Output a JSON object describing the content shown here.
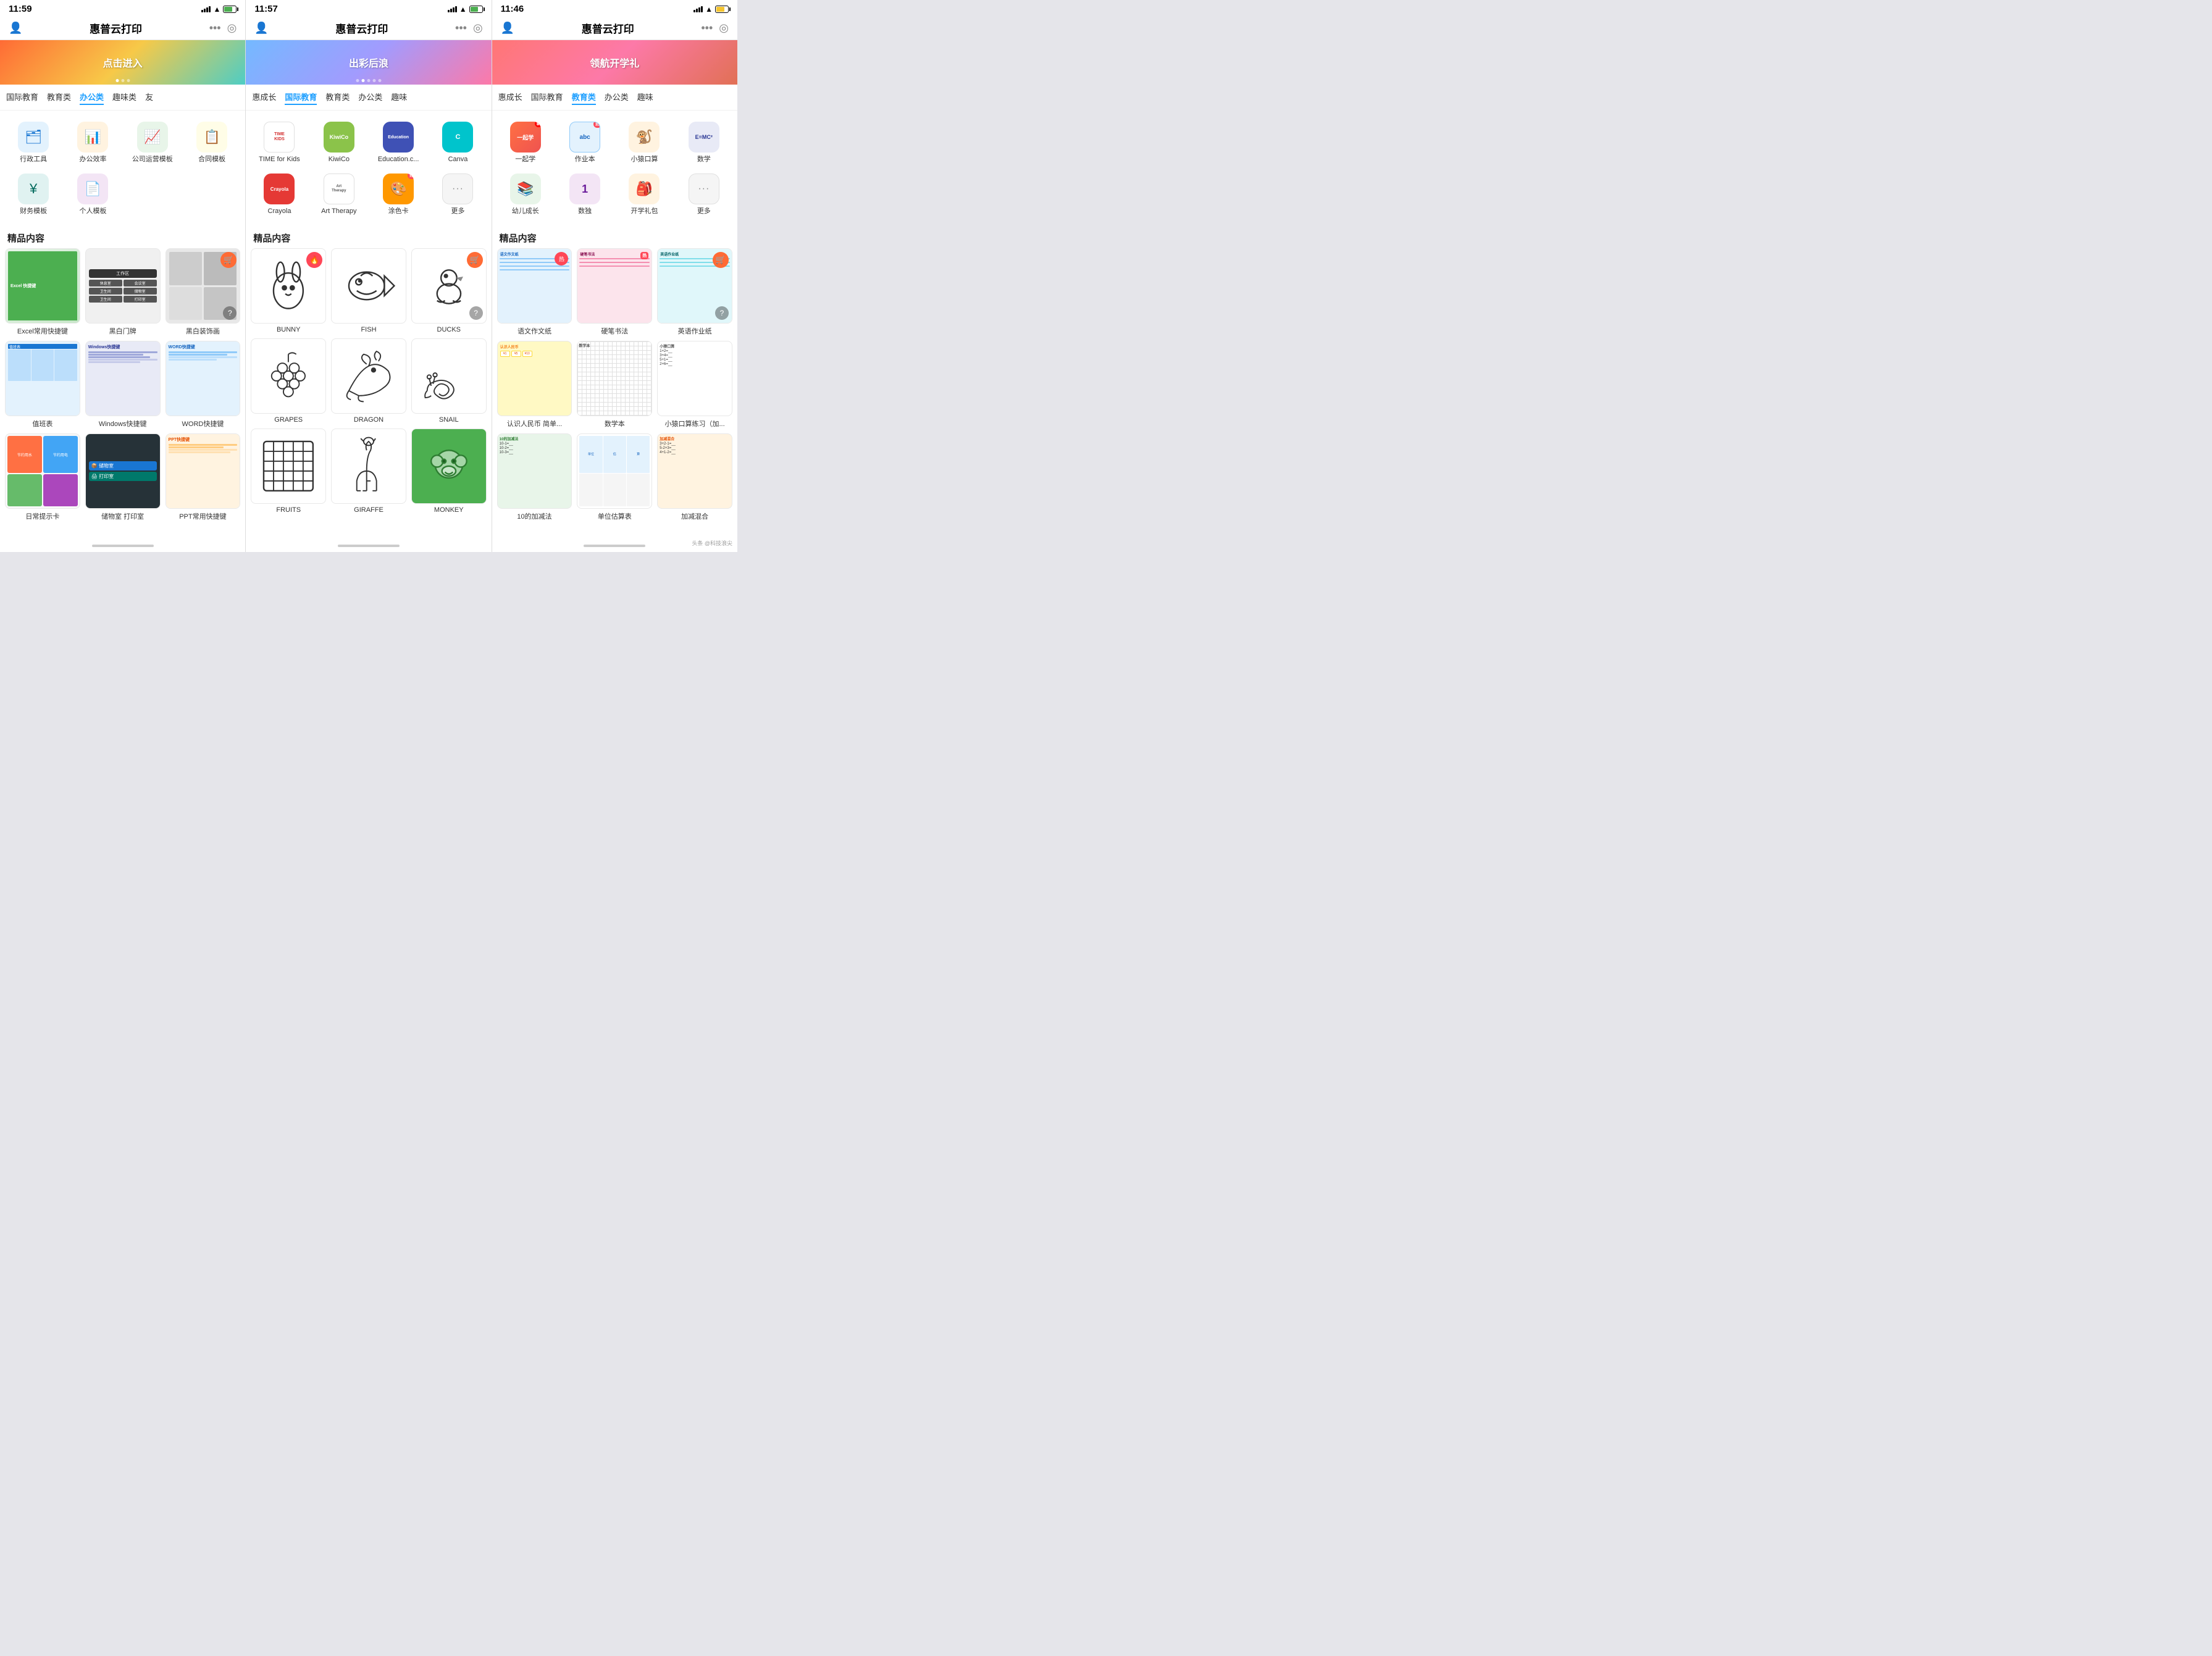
{
  "screens": [
    {
      "id": "screen-1",
      "time": "11:59",
      "header_title": "惠普云打印",
      "banner_text": "点击进入",
      "banner_class": "banner-1",
      "categories": [
        "国际教育",
        "教育类",
        "办公类",
        "趣味类",
        "友"
      ],
      "active_cat": 2,
      "apps": [
        {
          "label": "行政工具",
          "icon": "🗂",
          "bg": "icon-blue"
        },
        {
          "label": "办公效率",
          "icon": "📊",
          "bg": "icon-orange"
        },
        {
          "label": "公司运营模板",
          "icon": "📈",
          "bg": "icon-green"
        },
        {
          "label": "合同模板",
          "icon": "📋",
          "bg": "icon-yellow"
        },
        {
          "label": "财务模板",
          "icon": "¥",
          "bg": "icon-teal"
        },
        {
          "label": "个人模板",
          "icon": "📄",
          "bg": "icon-purple"
        }
      ],
      "section_label": "精品内容",
      "content_items": [
        {
          "label": "Excel常用快捷键",
          "type": "excel",
          "has_hot": false
        },
        {
          "label": "黑白门牌",
          "type": "door",
          "has_hot": false
        },
        {
          "label": "黑白装饰画",
          "type": "decor",
          "has_cart": true,
          "has_help": true
        },
        {
          "label": "值班表",
          "type": "table",
          "has_hot": false
        },
        {
          "label": "Windows快捷键",
          "type": "windows",
          "has_hot": false
        },
        {
          "label": "WORD快捷键",
          "type": "word",
          "has_hot": false
        },
        {
          "label": "日常提示卡",
          "type": "notice",
          "has_hot": false
        },
        {
          "label": "储物室 打印室",
          "type": "storage",
          "has_hot": false
        },
        {
          "label": "PPT常用快捷键",
          "type": "ppt",
          "has_hot": false
        }
      ]
    },
    {
      "id": "screen-2",
      "time": "11:57",
      "header_title": "惠普云打印",
      "banner_text": "出彩后浪",
      "banner_class": "banner-2",
      "categories": [
        "惠成长",
        "国际教育",
        "教育类",
        "办公类",
        "趣味"
      ],
      "active_cat": 1,
      "apps": [
        {
          "label": "TIME for Kids",
          "icon": "TIME\nKIDS",
          "bg": "app-icon-timekids",
          "type": "timekids"
        },
        {
          "label": "KiwiCo",
          "icon": "KiwiCo",
          "bg": "app-icon-kiwico",
          "type": "kiwico"
        },
        {
          "label": "Education.c...",
          "icon": "Education",
          "bg": "app-icon-education",
          "type": "education"
        },
        {
          "label": "Canva",
          "icon": "Canva",
          "bg": "app-icon-canva",
          "type": "canva"
        },
        {
          "label": "Crayola",
          "icon": "Crayola",
          "bg": "app-icon-crayola",
          "type": "crayola"
        },
        {
          "label": "Art Therapy",
          "icon": "Art\nTherapy",
          "bg": "app-icon-arttherapy",
          "type": "arttherapy"
        },
        {
          "label": "涂色卡",
          "icon": "🎨",
          "bg": "app-icon-coloring",
          "type": "coloring",
          "badge": "热"
        },
        {
          "label": "更多",
          "icon": "···",
          "bg": "app-icon-more",
          "type": "more"
        }
      ],
      "section_label": "精品内容",
      "content_items": [
        {
          "label": "BUNNY",
          "type": "bunny",
          "has_hot": true
        },
        {
          "label": "FISH",
          "type": "fish",
          "has_hot": false
        },
        {
          "label": "DUCKS",
          "type": "ducks",
          "has_cart": true,
          "has_help": true
        },
        {
          "label": "GRAPES",
          "type": "grapes",
          "has_hot": false
        },
        {
          "label": "DRAGON",
          "type": "dragon",
          "has_hot": false
        },
        {
          "label": "SNAIL",
          "type": "snail",
          "has_hot": false
        },
        {
          "label": "FRUITS",
          "type": "fruits",
          "has_hot": false
        },
        {
          "label": "GIRAFFE",
          "type": "giraffe",
          "has_hot": false
        },
        {
          "label": "MONKEY",
          "type": "monkey2",
          "has_hot": false
        }
      ]
    },
    {
      "id": "screen-3",
      "time": "11:46",
      "header_title": "惠普云打印",
      "banner_text": "领航开学礼",
      "banner_class": "banner-3",
      "categories": [
        "惠成长",
        "国际教育",
        "教育类",
        "办公类",
        "趣味"
      ],
      "active_cat": 2,
      "apps": [
        {
          "label": "一起学",
          "icon": "一起学",
          "bg": "icon-yiqizi",
          "type": "yiqizi",
          "badge": "新"
        },
        {
          "label": "作业本",
          "icon": "abc",
          "bg": "icon-zuoyeben",
          "type": "zuoyeben",
          "badge": "热"
        },
        {
          "label": "小猿口算",
          "icon": "🐒",
          "bg": "icon-monkey",
          "type": "monkey"
        },
        {
          "label": "数学",
          "icon": "E=MC²",
          "bg": "icon-math",
          "type": "math"
        },
        {
          "label": "幼儿成长",
          "icon": "📚",
          "bg": "icon-child",
          "type": "child"
        },
        {
          "label": "数独",
          "icon": "1",
          "bg": "icon-sudoku",
          "type": "sudoku"
        },
        {
          "label": "开学礼包",
          "icon": "🎒",
          "bg": "icon-school",
          "type": "school"
        },
        {
          "label": "更多",
          "icon": "···",
          "bg": "app-icon-more",
          "type": "more"
        }
      ],
      "section_label": "精品内容",
      "content_items": [
        {
          "label": "语文作文纸",
          "type": "chinese_paper",
          "has_hot": true
        },
        {
          "label": "硬笔书法",
          "type": "calligraphy",
          "has_hot": true
        },
        {
          "label": "英语作业纸",
          "type": "english_paper",
          "has_cart": true,
          "has_help": true
        },
        {
          "label": "认识人民币 简单...",
          "type": "rmb",
          "has_hot": false
        },
        {
          "label": "数学本",
          "type": "math_book",
          "has_hot": false
        },
        {
          "label": "小猿口算练习（加...",
          "type": "math_calc",
          "has_hot": false
        },
        {
          "label": "10的加减法",
          "type": "addition",
          "has_hot": false
        },
        {
          "label": "单位估算表",
          "type": "unit_calc",
          "has_hot": false
        },
        {
          "label": "加减混合",
          "type": "mixed_calc",
          "has_hot": false
        }
      ]
    }
  ],
  "watermark": "头条 @科技浪尖"
}
